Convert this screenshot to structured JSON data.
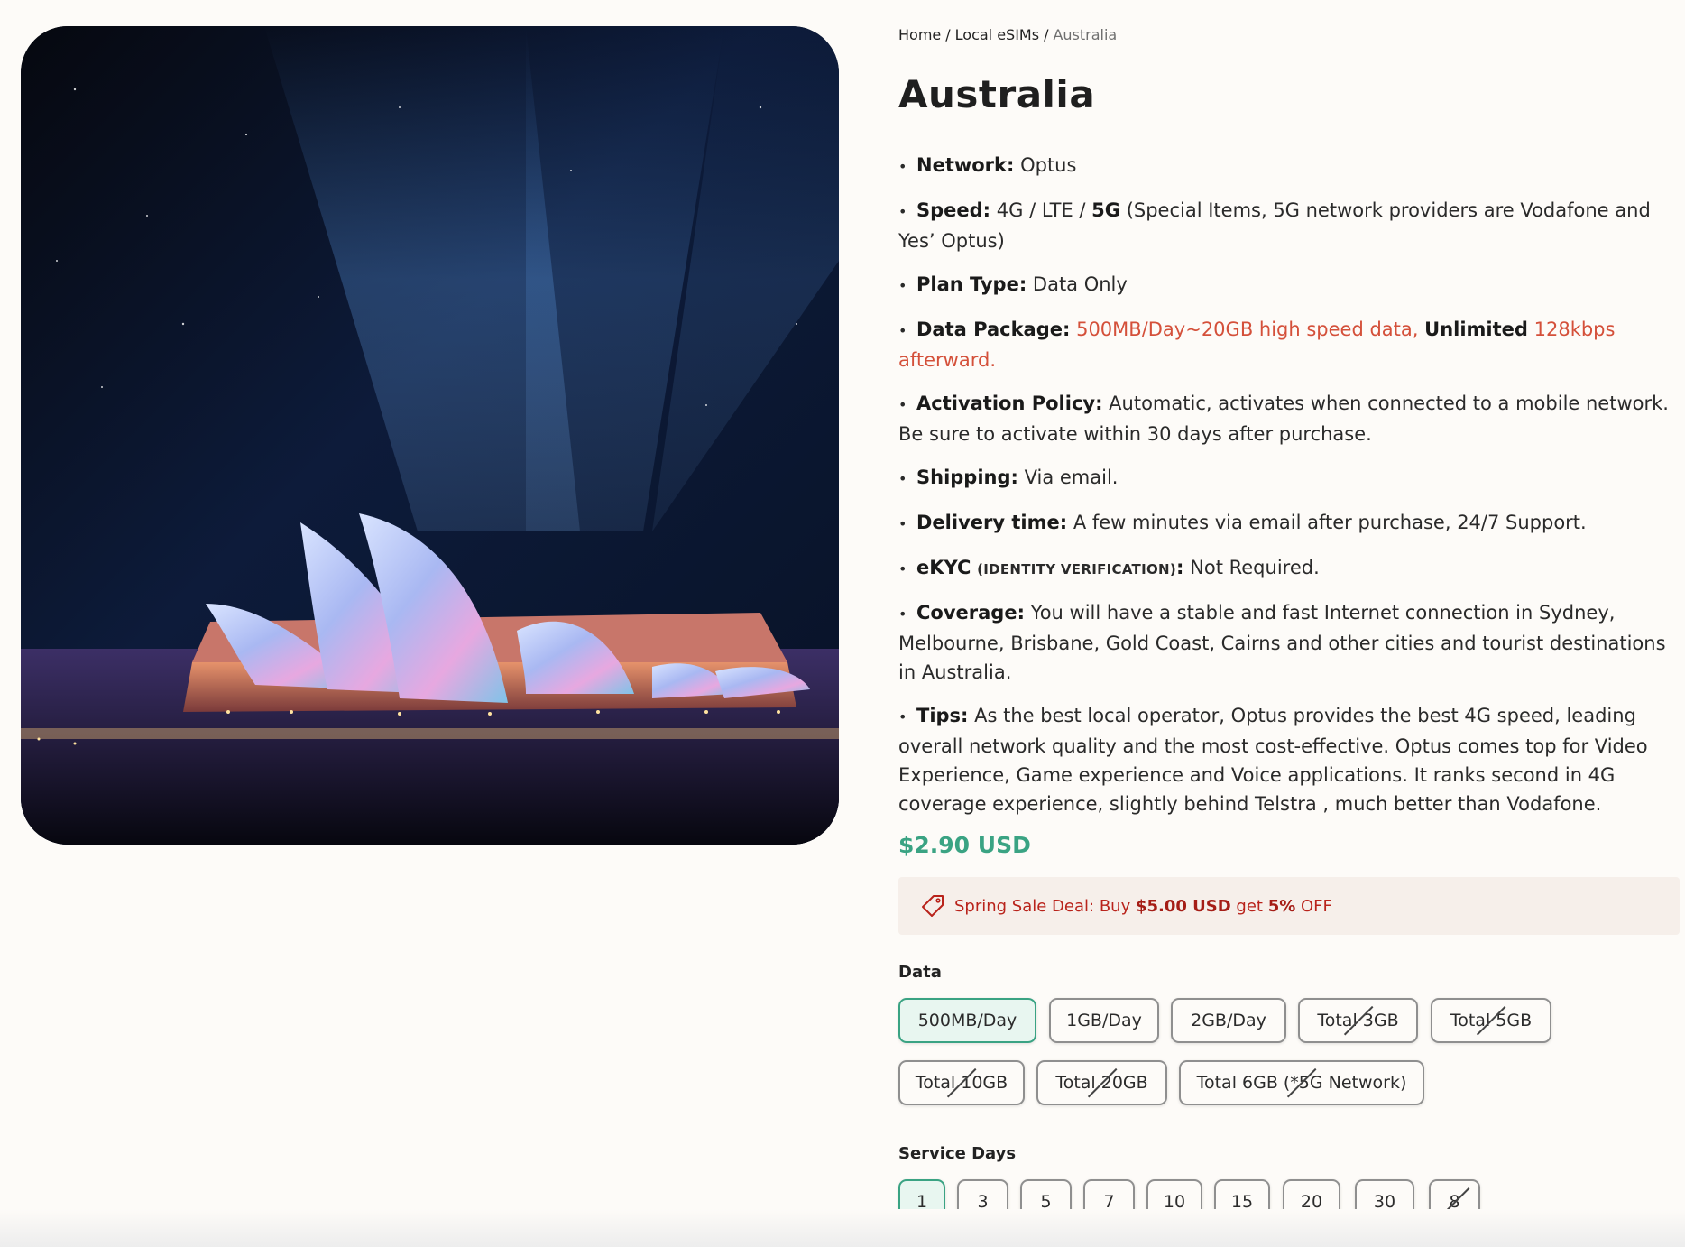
{
  "hero": {
    "alt": "Sydney Opera House illuminated at night"
  },
  "breadcrumb": {
    "home": "Home",
    "category": "Local eSIMs",
    "current": "Australia"
  },
  "title": "Australia",
  "features": [
    {
      "label": "Network:",
      "value": "Optus"
    },
    {
      "label": "Speed:",
      "value_pre": "4G / LTE / ",
      "value_highlight": "5G",
      "value_post": " (Special Items, 5G network providers are Vodafone and Yes’ Optus)"
    },
    {
      "label": "Plan Type:",
      "value": "Data Only"
    },
    {
      "label": "Data Package:",
      "value_pre": "500MB/Day~20GB high speed data, ",
      "value_highlight": "Unlimited",
      "value_post": " 128kbps afterward."
    },
    {
      "label": "Activation Policy:",
      "value": "Automatic, activates when connected to a mobile network. Be sure to activate within 30 days after purchase."
    },
    {
      "label": "Shipping:",
      "value": "Via email."
    },
    {
      "label": "Delivery time:",
      "value": "A few minutes via email after purchase, 24/7 Support."
    },
    {
      "label": "eKYC",
      "label_small": "(IDENTITY VERIFICATION)",
      "label_suffix": ":",
      "value": "Not Required."
    },
    {
      "label": "Coverage:",
      "value": "You will have a stable and fast Internet connection in Sydney, Melbourne, Brisbane, Gold Coast, Cairns and other cities and tourist destinations in Australia."
    },
    {
      "label": "Tips:",
      "value": "As the best local operator, Optus provides the best 4G speed, leading overall network quality and the most cost-effective. Optus comes top for Video Experience, Game experience and Voice applications. It ranks second in 4G coverage experience, slightly behind Telstra , much better than Vodafone."
    }
  ],
  "price": "$2.90 USD",
  "deal": {
    "pre": "Spring Sale Deal: Buy ",
    "amount": "$5.00 USD",
    "mid": " get ",
    "percent": "5%",
    "post": " OFF"
  },
  "data_section": {
    "label": "Data",
    "selected": "500MB/Day",
    "options": [
      "500MB/Day",
      "1GB/Day",
      "2GB/Day",
      "Total 3GB",
      "Total 5GB",
      "Total 10GB",
      "Total 20GB",
      "Total 6GB (*5G Network)"
    ],
    "unavailable": [
      "Total 3GB",
      "Total 5GB",
      "Total 10GB",
      "Total 20GB",
      "Total 6GB (*5G Network)"
    ]
  },
  "days_section": {
    "label": "Service Days",
    "selected": "1",
    "options": [
      "1",
      "3",
      "5",
      "7",
      "10",
      "15",
      "20",
      "30",
      "8"
    ],
    "unavailable": [
      "8"
    ]
  },
  "colors": {
    "accent_green": "#3aa383",
    "highlight_red": "#d4503a",
    "deal_red": "#b9231b",
    "deal_bg": "#f6efea"
  }
}
